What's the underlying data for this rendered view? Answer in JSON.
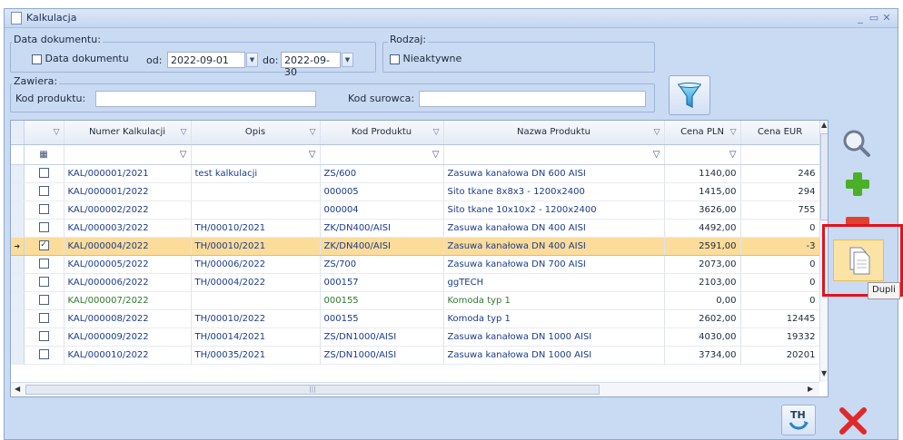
{
  "window": {
    "title": "Kalkulacja"
  },
  "filters": {
    "data_dokumentu_group": "Data dokumentu:",
    "data_dokumentu_checkbox": "Data dokumentu",
    "od_label": "od:",
    "od_value": "2022-09-01",
    "do_label": "do:",
    "do_value": "2022-09-30",
    "rodzaj_group": "Rodzaj:",
    "nieaktywne_checkbox": "Nieaktywne",
    "zawiera_group": "Zawiera:",
    "kod_produktu_label": "Kod produktu:",
    "kod_produktu_value": "",
    "kod_surowca_label": "Kod surowca:",
    "kod_surowca_value": ""
  },
  "grid": {
    "columns": [
      "Numer Kalkulacji",
      "Opis",
      "Kod Produktu",
      "Nazwa Produktu",
      "Cena PLN",
      "Cena EUR"
    ],
    "rows": [
      {
        "numer": "KAL/000001/2021",
        "opis": "test kalkulacji",
        "kod": "ZS/600",
        "nazwa": "Zasuwa kanałowa DN 600 AISI",
        "pln": "1140,00",
        "eur": "246",
        "checked": false,
        "color": "blue"
      },
      {
        "numer": "KAL/000001/2022",
        "opis": "",
        "kod": "000005",
        "nazwa": "Sito tkane 8x8x3 - 1200x2400",
        "pln": "1415,00",
        "eur": "294",
        "checked": false,
        "color": "blue"
      },
      {
        "numer": "KAL/000002/2022",
        "opis": "",
        "kod": "000004",
        "nazwa": "Sito tkane 10x10x2 - 1200x2400",
        "pln": "3626,00",
        "eur": "755",
        "checked": false,
        "color": "blue"
      },
      {
        "numer": "KAL/000003/2022",
        "opis": "TH/00010/2021",
        "kod": "ZK/DN400/AISI",
        "nazwa": "Zasuwa kanałowa DN 400 AISI",
        "pln": "4492,00",
        "eur": "0",
        "checked": false,
        "color": "blue"
      },
      {
        "numer": "KAL/000004/2022",
        "opis": "TH/00010/2021",
        "kod": "ZK/DN400/AISI",
        "nazwa": "Zasuwa kanałowa DN 400 AISI",
        "pln": "2591,00",
        "eur": "-3",
        "checked": true,
        "color": "blue",
        "selected": true
      },
      {
        "numer": "KAL/000005/2022",
        "opis": "TH/00006/2022",
        "kod": "ZS/700",
        "nazwa": "Zasuwa kanałowa DN 700 AISI",
        "pln": "2073,00",
        "eur": "0",
        "checked": false,
        "color": "blue"
      },
      {
        "numer": "KAL/000006/2022",
        "opis": "TH/00004/2022",
        "kod": "000157",
        "nazwa": "ggTECH",
        "pln": "2103,00",
        "eur": "0",
        "checked": false,
        "color": "blue"
      },
      {
        "numer": "KAL/000007/2022",
        "opis": "",
        "kod": "000155",
        "nazwa": "Komoda typ 1",
        "pln": "0,00",
        "eur": "0",
        "checked": false,
        "color": "green"
      },
      {
        "numer": "KAL/000008/2022",
        "opis": "TH/00010/2022",
        "kod": "000155",
        "nazwa": "Komoda typ 1",
        "pln": "2602,00",
        "eur": "12445",
        "checked": false,
        "color": "blue"
      },
      {
        "numer": "KAL/000009/2022",
        "opis": "TH/00014/2021",
        "kod": "ZS/DN1000/AISI",
        "nazwa": "Zasuwa kanałowa DN 1000 AISI",
        "pln": "4030,00",
        "eur": "19332",
        "checked": false,
        "color": "blue"
      },
      {
        "numer": "KAL/000010/2022",
        "opis": "TH/00035/2021",
        "kod": "ZS/DN1000/AISI",
        "nazwa": "Zasuwa kanałowa DN 1000 AISI",
        "pln": "3734,00",
        "eur": "20201",
        "checked": false,
        "color": "blue"
      }
    ]
  },
  "tooltip": "Dupli",
  "icons": {
    "search": "search-icon",
    "add": "plus-icon",
    "remove": "minus-icon",
    "duplicate": "copy-icon",
    "th": "th-transfer-icon",
    "close": "close-x-icon",
    "filter": "funnel-icon"
  },
  "colors": {
    "window_bg": "#c9daf3",
    "selection": "#fbdc9a",
    "highlight_box": "#e2121c",
    "add_green": "#4caf28",
    "remove_red": "#e0412f"
  }
}
